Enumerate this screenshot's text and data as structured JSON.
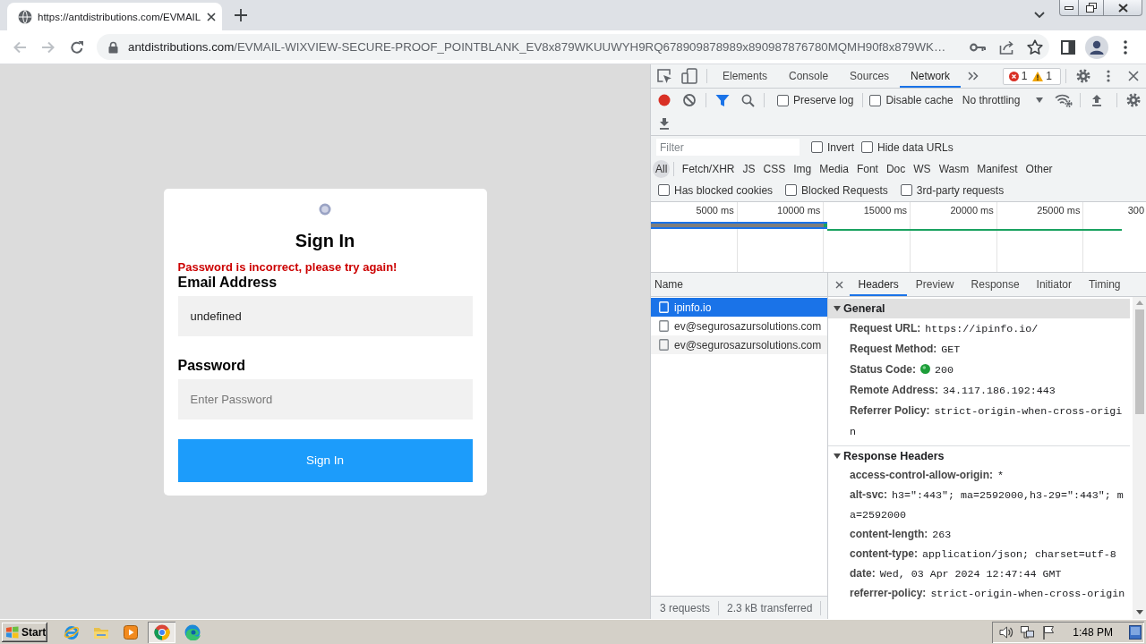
{
  "browser": {
    "tabs": [
      {
        "title": "https://antdistributions.com/EVMAIL",
        "selected": true
      }
    ],
    "address_bar": {
      "domain": "antdistributions.com",
      "path": "/EVMAIL-WIXVIEW-SECURE-PROOF_POINTBLANK_EV8x879WKUUWYH9RQ678909878989x890987876780MQMH90f8x879WK…"
    }
  },
  "page": {
    "login": {
      "title": "Sign In",
      "error": "Password is incorrect, please try again!",
      "fields": [
        {
          "label": "Email Address",
          "value": "undefined"
        },
        {
          "label": "Password",
          "placeholder": "Enter Password"
        }
      ],
      "button": "Sign In"
    }
  },
  "devtools": {
    "tabs": [
      {
        "label": "Elements",
        "selected": false
      },
      {
        "label": "Console",
        "selected": false
      },
      {
        "label": "Sources",
        "selected": false
      },
      {
        "label": "Network",
        "selected": true
      }
    ],
    "issues": {
      "errors": "1",
      "warnings": "1"
    },
    "toolbar": {
      "recording": true,
      "options": [
        {
          "label": "Preserve log",
          "checked": false
        },
        {
          "label": "Disable cache",
          "checked": false
        }
      ],
      "throttling": "No throttling"
    },
    "filter": {
      "placeholder": "Filter",
      "options": [
        {
          "label": "Invert",
          "checked": false
        },
        {
          "label": "Hide data URLs",
          "checked": false
        }
      ]
    },
    "type_filters": [
      {
        "label": "All",
        "selected": true
      },
      {
        "label": "Fetch/XHR",
        "selected": false
      },
      {
        "label": "JS",
        "selected": false
      },
      {
        "label": "CSS",
        "selected": false
      },
      {
        "label": "Img",
        "selected": false
      },
      {
        "label": "Media",
        "selected": false
      },
      {
        "label": "Font",
        "selected": false
      },
      {
        "label": "Doc",
        "selected": false
      },
      {
        "label": "WS",
        "selected": false
      },
      {
        "label": "Wasm",
        "selected": false
      },
      {
        "label": "Manifest",
        "selected": false
      },
      {
        "label": "Other",
        "selected": false
      }
    ],
    "extra_filters": [
      {
        "label": "Has blocked cookies",
        "checked": false
      },
      {
        "label": "Blocked Requests",
        "checked": false
      },
      {
        "label": "3rd-party requests",
        "checked": false
      }
    ],
    "overview": {
      "ticks": [
        "5000 ms",
        "10000 ms",
        "15000 ms",
        "20000 ms",
        "25000 ms",
        "300"
      ]
    },
    "requests": {
      "column": "Name",
      "rows": [
        {
          "name": "ipinfo.io",
          "selected": true
        },
        {
          "name": "ev@segurosazursolutions.com",
          "selected": false
        },
        {
          "name": "ev@segurosazursolutions.com",
          "selected": false
        }
      ],
      "summary": [
        "3 requests",
        "2.3 kB transferred"
      ]
    },
    "details": {
      "tabs": [
        {
          "label": "Headers",
          "selected": true
        },
        {
          "label": "Preview",
          "selected": false
        },
        {
          "label": "Response",
          "selected": false
        },
        {
          "label": "Initiator",
          "selected": false
        },
        {
          "label": "Timing",
          "selected": false
        }
      ],
      "sections": [
        {
          "title": "General",
          "expanded": true,
          "selected": true,
          "rows": [
            {
              "kind": "text",
              "name": "Request URL:",
              "value": "https://ipinfo.io/"
            },
            {
              "kind": "text",
              "name": "Request Method:",
              "value": "GET"
            },
            {
              "kind": "status",
              "name": "Status Code:",
              "value": "200"
            },
            {
              "kind": "text",
              "name": "Remote Address:",
              "value": "34.117.186.192:443"
            },
            {
              "kind": "text",
              "name": "Referrer Policy:",
              "value": "strict-origin-when-cross-origin"
            }
          ]
        },
        {
          "title": "Response Headers",
          "expanded": true,
          "selected": false,
          "rows": [
            {
              "kind": "text",
              "name": "access-control-allow-origin:",
              "value": "*"
            },
            {
              "kind": "text",
              "name": "alt-svc:",
              "value": "h3=\":443\"; ma=2592000,h3-29=\":443\"; ma=2592000"
            },
            {
              "kind": "text",
              "name": "content-length:",
              "value": "263"
            },
            {
              "kind": "text",
              "name": "content-type:",
              "value": "application/json; charset=utf-8"
            },
            {
              "kind": "text",
              "name": "date:",
              "value": "Wed, 03 Apr 2024 12:47:44 GMT"
            },
            {
              "kind": "text",
              "name": "referrer-policy:",
              "value": "strict-origin-when-cross-origin"
            }
          ]
        }
      ]
    }
  },
  "taskbar": {
    "start": "Start",
    "apps": [
      {
        "kind": "ie",
        "selected": false
      },
      {
        "kind": "explorer",
        "selected": false
      },
      {
        "kind": "media",
        "selected": false
      },
      {
        "kind": "chrome",
        "selected": true
      },
      {
        "kind": "edge",
        "selected": false
      }
    ],
    "clock": "1:48 PM"
  }
}
